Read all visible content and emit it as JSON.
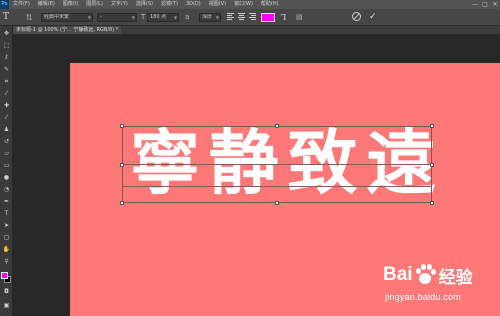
{
  "app": {
    "logo": "Ps"
  },
  "menu": [
    "文件(F)",
    "编辑(E)",
    "图像(I)",
    "图层(L)",
    "文字(Y)",
    "选择(S)",
    "滤镜(T)",
    "3D(D)",
    "视图(V)",
    "窗口(W)",
    "帮助(H)"
  ],
  "window_controls": {
    "minimize": "—",
    "maximize": "□",
    "close": "✕"
  },
  "options_bar": {
    "tool_icon": "T",
    "font_family": "经典中宋繁",
    "font_style": "-",
    "font_size": "180 点",
    "antialias": "浑厚",
    "text_color": "#ff00ff"
  },
  "document_tab": {
    "title": "未标题-1 @ 100% (宁... 宁静致远, RGB/8) *"
  },
  "canvas": {
    "background": "#fe7878",
    "text": [
      "寧",
      "静",
      "致",
      "遠"
    ],
    "text_color": "#ffffff"
  },
  "palette": {
    "foreground": "#ff00ff",
    "background": "#000000"
  },
  "watermark": {
    "brand_left": "Bai",
    "brand_right": "经验",
    "url": "jingyan.baidu.com"
  }
}
